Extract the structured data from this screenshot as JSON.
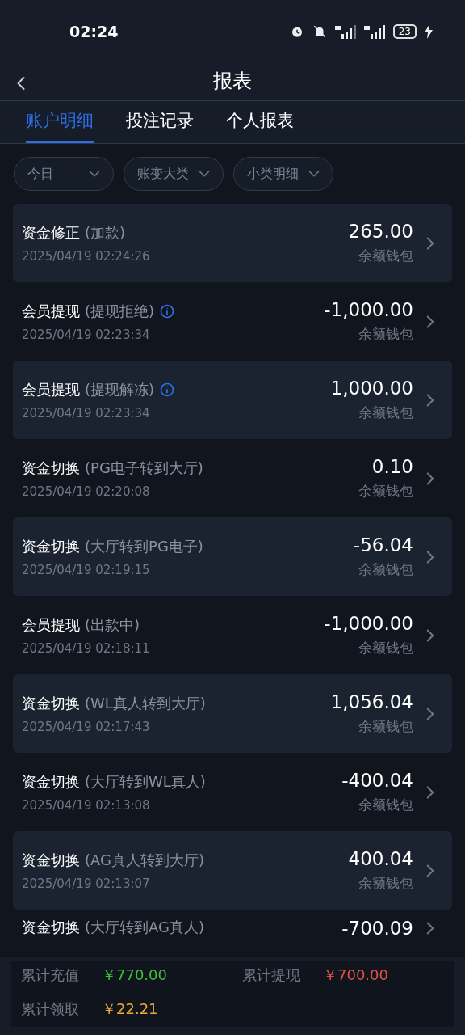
{
  "status_bar": {
    "time": "02:24",
    "battery": "23"
  },
  "header": {
    "title": "报表"
  },
  "tabs": [
    {
      "label": "账户明细",
      "selected": true
    },
    {
      "label": "投注记录",
      "selected": false
    },
    {
      "label": "个人报表",
      "selected": false
    }
  ],
  "filters": [
    {
      "label": "今日"
    },
    {
      "label": "账变大类"
    },
    {
      "label": "小类明细"
    }
  ],
  "records": [
    {
      "title": "资金修正",
      "detail": "(加款)",
      "info": false,
      "time": "2025/04/19 02:24:26",
      "amount": "265.00",
      "wallet": "余额钱包",
      "shaded": true
    },
    {
      "title": "会员提现",
      "detail": "(提现拒绝)",
      "info": true,
      "time": "2025/04/19 02:23:34",
      "amount": "-1,000.00",
      "wallet": "余额钱包",
      "shaded": false
    },
    {
      "title": "会员提现",
      "detail": "(提现解冻)",
      "info": true,
      "time": "2025/04/19 02:23:34",
      "amount": "1,000.00",
      "wallet": "余额钱包",
      "shaded": true
    },
    {
      "title": "资金切换",
      "detail": "(PG电子转到大厅)",
      "info": false,
      "time": "2025/04/19 02:20:08",
      "amount": "0.10",
      "wallet": "余额钱包",
      "shaded": false
    },
    {
      "title": "资金切换",
      "detail": "(大厅转到PG电子)",
      "info": false,
      "time": "2025/04/19 02:19:15",
      "amount": "-56.04",
      "wallet": "余额钱包",
      "shaded": true
    },
    {
      "title": "会员提现",
      "detail": "(出款中)",
      "info": false,
      "time": "2025/04/19 02:18:11",
      "amount": "-1,000.00",
      "wallet": "余额钱包",
      "shaded": false
    },
    {
      "title": "资金切换",
      "detail": "(WL真人转到大厅)",
      "info": false,
      "time": "2025/04/19 02:17:43",
      "amount": "1,056.04",
      "wallet": "余额钱包",
      "shaded": true
    },
    {
      "title": "资金切换",
      "detail": "(大厅转到WL真人)",
      "info": false,
      "time": "2025/04/19 02:13:08",
      "amount": "-400.04",
      "wallet": "余额钱包",
      "shaded": false
    },
    {
      "title": "资金切换",
      "detail": "(AG真人转到大厅)",
      "info": false,
      "time": "2025/04/19 02:13:07",
      "amount": "400.04",
      "wallet": "余额钱包",
      "shaded": true
    },
    {
      "title": "资金切换",
      "detail": "(大厅转到AG真人)",
      "info": false,
      "amount": "-700.09",
      "shaded": false
    }
  ],
  "summary": [
    {
      "label": "累计充值",
      "value": "￥770.00",
      "color": "#3fbf3a"
    },
    {
      "label": "累计提现",
      "value": "￥700.00",
      "color": "#e0524a"
    },
    {
      "label": "累计领取",
      "value": "￥22.21",
      "color": "#e8a93a"
    }
  ]
}
